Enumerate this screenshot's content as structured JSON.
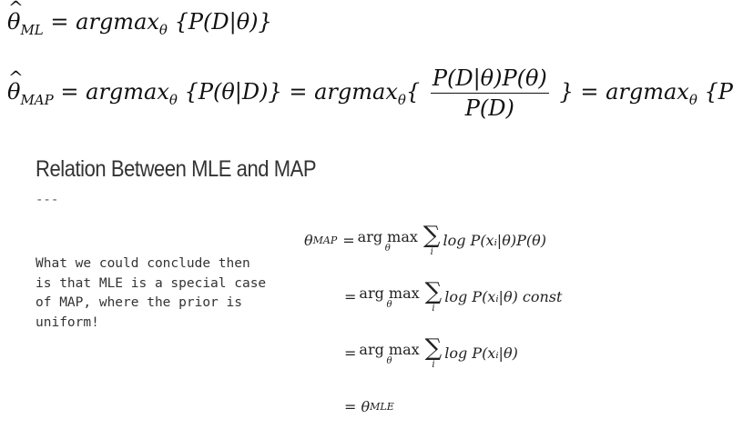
{
  "equations": {
    "ml": {
      "lhs": "θ",
      "lhs_sub": "ML",
      "rhs_start": "= argmax",
      "rhs_sub": "θ",
      "rhs_end": "{P(D|θ)}"
    },
    "map": {
      "lhs": "θ",
      "lhs_sub": "MAP",
      "part1": "= argmax",
      "part1_sub": "θ",
      "part1_end": "{P(θ|D)} = argmax",
      "part2_sub": "θ",
      "part2_open": "{",
      "frac_num": "P(D|θ)P(θ)",
      "frac_den": "P(D)",
      "part3": "} = argmax",
      "part3_sub": "θ",
      "part3_end": "{P(D|θ)P(θ)"
    }
  },
  "section": {
    "title": "Relation Between MLE and MAP",
    "separator": "---",
    "text": "What we could conclude then\nis that MLE is a special case\nof MAP, where the prior is\nuniform!"
  },
  "derivation": {
    "lhs": "θ",
    "lhs_sub": "MAP",
    "op": "arg max",
    "op_under": "θ",
    "sum_under": "i",
    "rows": [
      {
        "prefix": "= ",
        "expr": "log P(xᵢ|θ)P(θ)"
      },
      {
        "prefix": "= ",
        "expr": "log P(xᵢ|θ) const"
      },
      {
        "prefix": "= ",
        "expr": "log P(xᵢ|θ)"
      }
    ],
    "final_prefix": "= θ",
    "final_sub": "MLE"
  }
}
